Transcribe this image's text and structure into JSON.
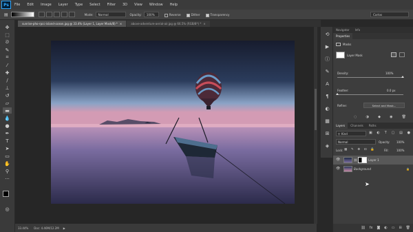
{
  "app": {
    "logo": "Ps"
  },
  "menu": [
    "File",
    "Edit",
    "Image",
    "Layer",
    "Type",
    "Select",
    "Filter",
    "3D",
    "View",
    "Window",
    "Help"
  ],
  "options": {
    "mode_label": "Mode:",
    "mode_value": "Normal",
    "opacity_label": "Opacity:",
    "opacity_value": "100%",
    "reverse_label": "Reverse",
    "dither_label": "Dither",
    "transparency_label": "Transparency",
    "workspace": "Carlos"
  },
  "tabs": [
    {
      "label": "sunrise-pho-rpcc-island-ocean.jpg @ 33.4% (Layer 1, Layer Mask/8) *",
      "active": true
    },
    {
      "label": "above-adventure-aerial-air.jpg @ 66.5% (RGB/8*) *",
      "active": false
    }
  ],
  "status": {
    "zoom": "33.44%",
    "info": "Doc: 4.46M/12.2M"
  },
  "properties": {
    "tabs": [
      "Navigator",
      "Info",
      "Properties"
    ],
    "section": "Masks",
    "mask_label": "Layer Mask",
    "density_label": "Density:",
    "density_value": "100%",
    "feather_label": "Feather:",
    "feather_value": "0.0 px",
    "refine_label": "Refine:",
    "select_mask_button": "Select and Mask..."
  },
  "layers": {
    "tabs": [
      "Layers",
      "Channels",
      "Paths"
    ],
    "filter": "Kind",
    "blend_mode": "Normal",
    "opacity_label": "Opacity:",
    "opacity_value": "100%",
    "lock_label": "Lock:",
    "fill_label": "Fill:",
    "fill_value": "100%",
    "items": [
      {
        "name": "Layer 1",
        "active": true
      },
      {
        "name": "Background",
        "active": false
      }
    ]
  },
  "colors": {
    "accent": "#31a8ff",
    "sky_top": "#1c2338",
    "horizon": "#c88aa6",
    "water": "#6a5b8a"
  }
}
